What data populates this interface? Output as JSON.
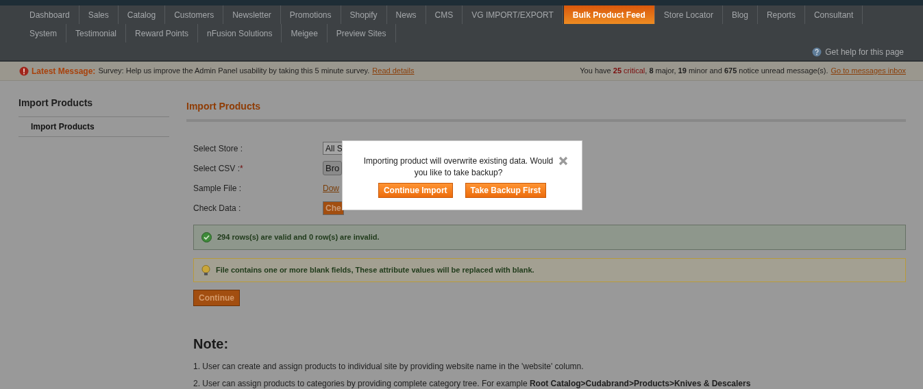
{
  "nav": {
    "items": [
      {
        "label": "Dashboard",
        "selected": false
      },
      {
        "label": "Sales",
        "selected": false
      },
      {
        "label": "Catalog",
        "selected": false
      },
      {
        "label": "Customers",
        "selected": false
      },
      {
        "label": "Newsletter",
        "selected": false
      },
      {
        "label": "Promotions",
        "selected": false
      },
      {
        "label": "Shopify",
        "selected": false
      },
      {
        "label": "News",
        "selected": false
      },
      {
        "label": "CMS",
        "selected": false
      },
      {
        "label": "VG IMPORT/EXPORT",
        "selected": false
      },
      {
        "label": "Bulk Product Feed",
        "selected": true
      },
      {
        "label": "Store Locator",
        "selected": false
      },
      {
        "label": "Blog",
        "selected": false
      },
      {
        "label": "Reports",
        "selected": false
      },
      {
        "label": "Consultant",
        "selected": false
      },
      {
        "label": "System",
        "selected": false
      },
      {
        "label": "Testimonial",
        "selected": false
      },
      {
        "label": "Reward Points",
        "selected": false
      },
      {
        "label": "nFusion Solutions",
        "selected": false
      },
      {
        "label": "Meigee",
        "selected": false
      },
      {
        "label": "Preview Sites",
        "selected": false
      }
    ],
    "help_link": "Get help for this page"
  },
  "message_bar": {
    "label": "Latest Message:",
    "text": "Survey: Help us improve the Admin Panel usability by taking this 5 minute survey.",
    "link": "Read details",
    "summary": [
      {
        "text": "You have ",
        "kind": "plain"
      },
      {
        "text": "25",
        "kind": "critical-count"
      },
      {
        "text": " critical",
        "kind": "critical"
      },
      {
        "text": ", ",
        "kind": "plain"
      },
      {
        "text": "8",
        "kind": "count"
      },
      {
        "text": " major, ",
        "kind": "plain"
      },
      {
        "text": "19",
        "kind": "count"
      },
      {
        "text": " minor and ",
        "kind": "plain"
      },
      {
        "text": "675",
        "kind": "count"
      },
      {
        "text": " notice unread message(s).",
        "kind": "plain"
      }
    ],
    "inbox_link": "Go to messages inbox"
  },
  "sidebar": {
    "title": "Import Products",
    "items": [
      {
        "label": "Import Products",
        "selected": true
      }
    ]
  },
  "main": {
    "title": "Import Products",
    "form": [
      {
        "label": "Select Store :",
        "kind": "select",
        "value": "All S"
      },
      {
        "label": "Select CSV :",
        "required_mark": "*",
        "kind": "file",
        "value": "Bro"
      },
      {
        "label": "Sample File :",
        "kind": "link",
        "value": "Dow"
      },
      {
        "label": "Check Data :",
        "kind": "button",
        "value": "Che"
      }
    ],
    "messages": [
      {
        "kind": "success",
        "text": "294 rows(s) are valid and 0 row(s) are invalid."
      },
      {
        "kind": "notice",
        "text": "File contains one or more blank fields, These attribute values will be replaced with blank."
      }
    ],
    "continue_button": "Continue",
    "note": {
      "title": "Note:",
      "items": [
        "1. User can create and assign products to individual site by providing website name in the 'website' column.",
        "2. User can assign products to categories by providing complete category tree. For example **Root Catalog>Cudabrand>Products>Knives & Descalers**"
      ]
    }
  },
  "dialog": {
    "text": "Importing product will overwrite existing data. Would you like to take backup?",
    "buttons": [
      "Continue Import",
      "Take Backup First"
    ]
  }
}
